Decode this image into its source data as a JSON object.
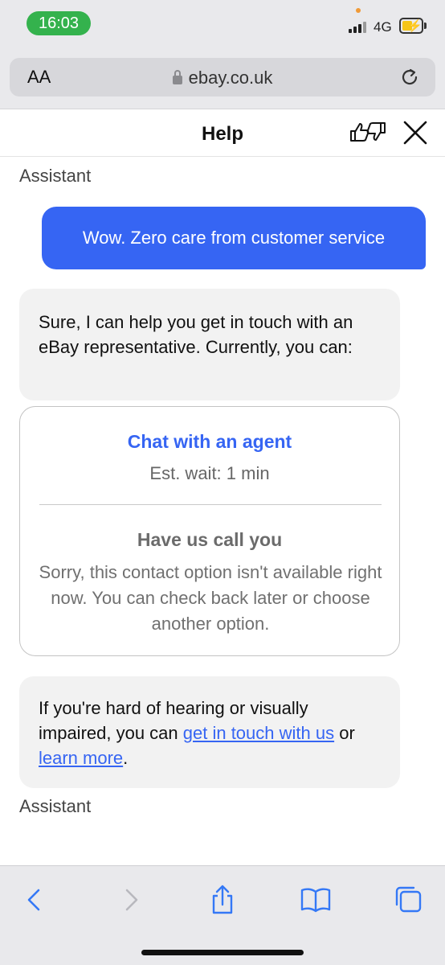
{
  "status_bar": {
    "time": "16:03",
    "network": "4G",
    "colors": {
      "time_pill": "#34b24d",
      "battery_fill": "#f5c518"
    }
  },
  "browser": {
    "text_size_button": "AA",
    "url": "ebay.co.uk",
    "icons": [
      "lock-icon",
      "reload-icon"
    ]
  },
  "help_header": {
    "title": "Help",
    "icons": [
      "thumbs-feedback-icon",
      "close-icon"
    ]
  },
  "chat": {
    "top_sender": "Assistant",
    "user_message": "Wow. Zero care from customer service",
    "bot_message": "Sure, I can help you get in touch with an eBay representative. Currently, you can:",
    "contact_card": {
      "chat_option": "Chat with an agent",
      "chat_wait": "Est. wait: 1 min",
      "call_option": "Have us call you",
      "call_unavailable": "Sorry, this contact option isn't available right now. You can check back later or choose another option."
    },
    "accessibility_message": {
      "prefix": "If you're hard of hearing or visually impaired, you can ",
      "link1": "get in touch with us",
      "middle": " or ",
      "link2": "learn more",
      "suffix": "."
    },
    "bottom_sender": "Assistant",
    "colors": {
      "user_bubble": "#3665f3",
      "bot_bubble": "#f2f2f2",
      "link": "#3665f3"
    }
  },
  "toolbar": {
    "icons": [
      "back-icon",
      "forward-icon",
      "share-icon",
      "bookmarks-icon",
      "tabs-icon"
    ],
    "accent": "#3478f6"
  }
}
